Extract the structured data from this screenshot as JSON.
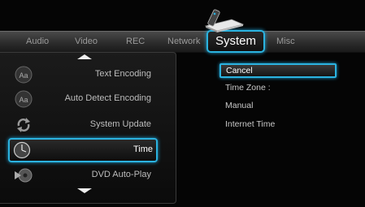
{
  "tabs": [
    {
      "label": "Audio",
      "icon": ""
    },
    {
      "label": "Video",
      "icon": ""
    },
    {
      "label": "REC",
      "icon": ""
    },
    {
      "label": "Network",
      "icon": ""
    },
    {
      "label": "System",
      "icon": "media-player-remote-icon"
    },
    {
      "label": "Misc",
      "icon": ""
    }
  ],
  "menu": {
    "items": [
      {
        "label": "Text Encoding",
        "icon": "aa-text-icon"
      },
      {
        "label": "Auto Detect Encoding",
        "icon": "aa-text-icon"
      },
      {
        "label": "System Update",
        "icon": "update-arrows-icon"
      },
      {
        "label": "Time",
        "icon": "clock-icon"
      },
      {
        "label": "DVD Auto-Play",
        "icon": "disc-play-icon"
      }
    ],
    "selected": "Time"
  },
  "options": {
    "items": [
      "Cancel",
      "Time Zone :",
      "Manual",
      "Internet Time"
    ],
    "selected": "Cancel"
  },
  "colors": {
    "accent": "#2bb3e0",
    "background": "#050505"
  }
}
